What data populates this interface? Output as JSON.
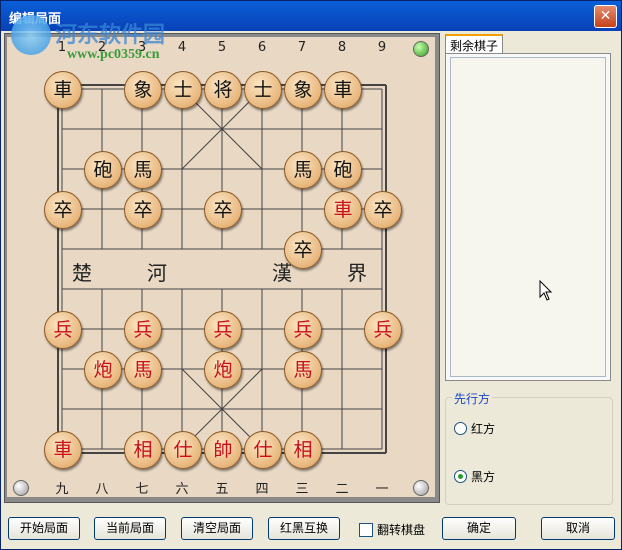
{
  "window": {
    "title": "编辑局面",
    "close_label": "✕"
  },
  "watermark": {
    "name": "河东软件园",
    "url": "www.pc0359.cn"
  },
  "board": {
    "top_files": [
      "1",
      "2",
      "3",
      "4",
      "5",
      "6",
      "7",
      "8",
      "9"
    ],
    "bottom_files": [
      "九",
      "八",
      "七",
      "六",
      "五",
      "四",
      "三",
      "二",
      "一"
    ],
    "river_left": [
      "楚",
      "河"
    ],
    "river_right": [
      "漢",
      "界"
    ],
    "pieces": [
      {
        "t": "車",
        "c": "black",
        "f": 1,
        "r": 1
      },
      {
        "t": "象",
        "c": "black",
        "f": 3,
        "r": 1
      },
      {
        "t": "士",
        "c": "black",
        "f": 4,
        "r": 1
      },
      {
        "t": "将",
        "c": "black",
        "f": 5,
        "r": 1
      },
      {
        "t": "士",
        "c": "black",
        "f": 6,
        "r": 1
      },
      {
        "t": "象",
        "c": "black",
        "f": 7,
        "r": 1
      },
      {
        "t": "車",
        "c": "black",
        "f": 8,
        "r": 1
      },
      {
        "t": "砲",
        "c": "black",
        "f": 2,
        "r": 3
      },
      {
        "t": "馬",
        "c": "black",
        "f": 3,
        "r": 3
      },
      {
        "t": "馬",
        "c": "black",
        "f": 7,
        "r": 3
      },
      {
        "t": "砲",
        "c": "black",
        "f": 8,
        "r": 3
      },
      {
        "t": "卒",
        "c": "black",
        "f": 1,
        "r": 4
      },
      {
        "t": "卒",
        "c": "black",
        "f": 3,
        "r": 4
      },
      {
        "t": "卒",
        "c": "black",
        "f": 5,
        "r": 4
      },
      {
        "t": "車",
        "c": "red",
        "f": 8,
        "r": 4
      },
      {
        "t": "卒",
        "c": "black",
        "f": 9,
        "r": 4
      },
      {
        "t": "卒",
        "c": "black",
        "f": 7,
        "r": 5
      },
      {
        "t": "兵",
        "c": "red",
        "f": 1,
        "r": 7
      },
      {
        "t": "兵",
        "c": "red",
        "f": 3,
        "r": 7
      },
      {
        "t": "兵",
        "c": "red",
        "f": 5,
        "r": 7
      },
      {
        "t": "兵",
        "c": "red",
        "f": 7,
        "r": 7
      },
      {
        "t": "兵",
        "c": "red",
        "f": 9,
        "r": 7
      },
      {
        "t": "炮",
        "c": "red",
        "f": 2,
        "r": 8
      },
      {
        "t": "馬",
        "c": "red",
        "f": 3,
        "r": 8
      },
      {
        "t": "炮",
        "c": "red",
        "f": 5,
        "r": 8
      },
      {
        "t": "馬",
        "c": "red",
        "f": 7,
        "r": 8
      },
      {
        "t": "車",
        "c": "red",
        "f": 1,
        "r": 10
      },
      {
        "t": "相",
        "c": "red",
        "f": 3,
        "r": 10
      },
      {
        "t": "仕",
        "c": "red",
        "f": 4,
        "r": 10
      },
      {
        "t": "帥",
        "c": "red",
        "f": 5,
        "r": 10
      },
      {
        "t": "仕",
        "c": "red",
        "f": 6,
        "r": 10
      },
      {
        "t": "相",
        "c": "red",
        "f": 7,
        "r": 10
      }
    ]
  },
  "side": {
    "tab_label": "剩余棋子",
    "group_title": "先行方",
    "radio_red": "红方",
    "radio_black": "黑方",
    "selected": "黑方"
  },
  "buttons": {
    "start": "开始局面",
    "current": "当前局面",
    "clear": "清空局面",
    "swap": "红黑互换",
    "flip": "翻转棋盘",
    "ok": "确定",
    "cancel": "取消"
  }
}
